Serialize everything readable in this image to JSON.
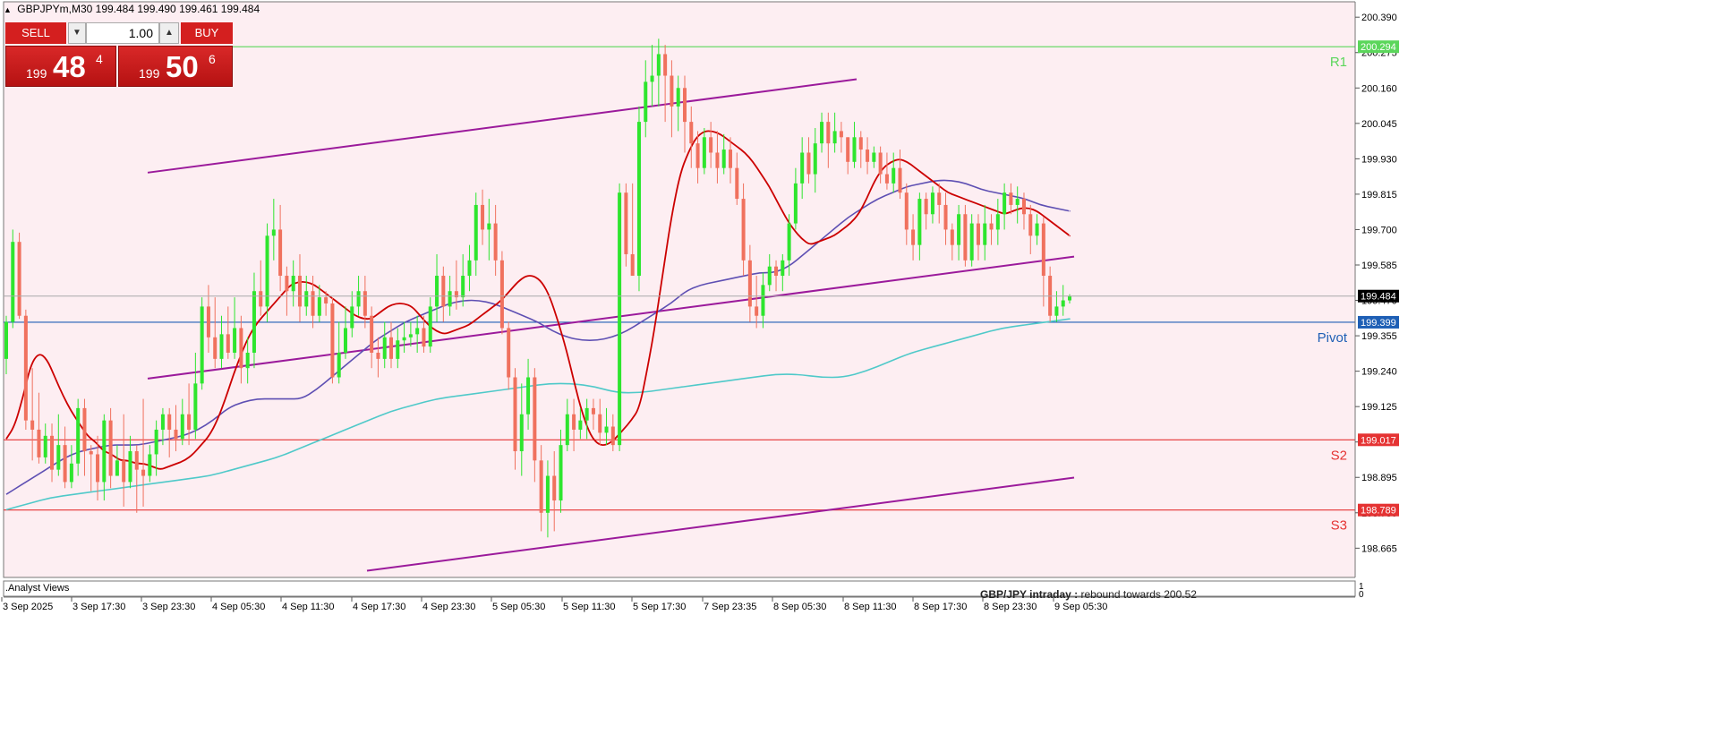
{
  "header": {
    "symbol_timeframe": "GBPJPYm,M30",
    "quote_values": "199.484 199.490 199.461 199.484"
  },
  "trade_panel": {
    "sell_label": "SELL",
    "buy_label": "BUY",
    "lot_value": "1.00",
    "sell_price": {
      "prefix": "199",
      "big": "48",
      "sup": "4"
    },
    "buy_price": {
      "prefix": "199",
      "big": "50",
      "sup": "6"
    }
  },
  "footer": {
    "analyst_label": ".Analyst Views",
    "caption_bold": "GBP/JPY intraday :",
    "caption_rest": " rebound towards 200.52",
    "lower_scale_top": "1",
    "lower_scale_bottom": "0"
  },
  "colors": {
    "background": "#fdeef2",
    "bull_candle": "#2ee52e",
    "bear_candle": "#f0715e",
    "channel": "#9b1a9b",
    "ma_fast": "#cc0000",
    "ma_mid": "#5e4fb3",
    "ma_slow": "#4fc9c9",
    "r1_line": "#5bd65b",
    "pivot_line": "#1e5fb5",
    "support_line": "#e53333"
  },
  "chart_data": {
    "type": "candlestick",
    "ylim": [
      198.57,
      200.44
    ],
    "y_ticks": [
      200.39,
      200.275,
      200.16,
      200.045,
      199.93,
      199.815,
      199.7,
      199.585,
      199.47,
      199.355,
      199.24,
      199.125,
      199.01,
      198.895,
      198.78,
      198.665
    ],
    "x_ticks": [
      "3 Sep 2025",
      "3 Sep 17:30",
      "3 Sep 23:30",
      "4 Sep 05:30",
      "4 Sep 11:30",
      "4 Sep 17:30",
      "4 Sep 23:30",
      "5 Sep 05:30",
      "5 Sep 11:30",
      "5 Sep 17:30",
      "7 Sep 23:35",
      "8 Sep 05:30",
      "8 Sep 11:30",
      "8 Sep 17:30",
      "8 Sep 23:30",
      "9 Sep 05:30"
    ],
    "current_price": 199.484,
    "levels": [
      {
        "name": "R1",
        "value": 200.294
      },
      {
        "name": "Pivot",
        "value": 199.399
      },
      {
        "name": "S2",
        "value": 199.017
      },
      {
        "name": "S3",
        "value": 198.789
      }
    ],
    "level_labels": [
      "200.294",
      "199.399",
      "199.017",
      "198.789"
    ],
    "current_label": "199.484",
    "candles": [
      [
        199.28,
        199.4,
        199.23,
        199.42
      ],
      [
        199.4,
        199.66,
        199.38,
        199.7
      ],
      [
        199.66,
        199.42,
        199.41,
        199.69
      ],
      [
        199.42,
        199.08,
        199.05,
        199.44
      ],
      [
        199.08,
        199.05,
        198.95,
        199.25
      ],
      [
        199.05,
        198.96,
        198.94,
        199.17
      ],
      [
        198.96,
        199.03,
        198.94,
        199.07
      ],
      [
        199.03,
        198.92,
        198.88,
        199.07
      ],
      [
        198.92,
        199.0,
        198.9,
        199.1
      ],
      [
        199.0,
        198.88,
        198.86,
        199.06
      ],
      [
        198.88,
        198.94,
        198.86,
        199.0
      ],
      [
        198.94,
        199.12,
        198.9,
        199.15
      ],
      [
        199.12,
        198.98,
        198.9,
        199.15
      ],
      [
        198.98,
        198.97,
        198.85,
        199.0
      ],
      [
        198.97,
        198.88,
        198.82,
        199.03
      ],
      [
        198.88,
        199.08,
        198.82,
        199.1
      ],
      [
        199.08,
        198.9,
        198.86,
        199.12
      ],
      [
        198.9,
        198.95,
        198.9,
        199.0
      ],
      [
        198.95,
        198.88,
        198.8,
        199.1
      ],
      [
        198.88,
        198.98,
        198.86,
        199.03
      ],
      [
        198.98,
        198.92,
        198.78,
        199.0
      ],
      [
        198.92,
        198.9,
        198.8,
        199.15
      ],
      [
        198.9,
        198.97,
        198.88,
        199.0
      ],
      [
        198.97,
        199.05,
        198.9,
        199.08
      ],
      [
        199.05,
        199.1,
        199.0,
        199.12
      ],
      [
        199.1,
        199.05,
        198.96,
        199.12
      ],
      [
        199.05,
        199.02,
        198.98,
        199.13
      ],
      [
        199.02,
        199.1,
        199.0,
        199.15
      ],
      [
        199.1,
        199.05,
        199.0,
        199.2
      ],
      [
        199.05,
        199.2,
        199.02,
        199.3
      ],
      [
        199.2,
        199.45,
        199.18,
        199.48
      ],
      [
        199.45,
        199.35,
        199.3,
        199.52
      ],
      [
        199.35,
        199.28,
        199.25,
        199.48
      ],
      [
        199.28,
        199.36,
        199.25,
        199.42
      ],
      [
        199.36,
        199.3,
        199.28,
        199.45
      ],
      [
        199.3,
        199.38,
        199.28,
        199.48
      ],
      [
        199.38,
        199.25,
        199.2,
        199.42
      ],
      [
        199.25,
        199.3,
        199.2,
        199.35
      ],
      [
        199.3,
        199.5,
        199.25,
        199.56
      ],
      [
        199.5,
        199.45,
        199.42,
        199.6
      ],
      [
        199.45,
        199.68,
        199.4,
        199.72
      ],
      [
        199.68,
        199.7,
        199.6,
        199.8
      ],
      [
        199.7,
        199.55,
        199.5,
        199.78
      ],
      [
        199.55,
        199.5,
        199.42,
        199.58
      ],
      [
        199.5,
        199.55,
        199.45,
        199.6
      ],
      [
        199.55,
        199.45,
        199.4,
        199.62
      ],
      [
        199.45,
        199.5,
        199.42,
        199.55
      ],
      [
        199.5,
        199.42,
        199.38,
        199.55
      ],
      [
        199.42,
        199.48,
        199.4,
        199.52
      ],
      [
        199.48,
        199.46,
        199.42,
        199.5
      ],
      [
        199.46,
        199.22,
        199.2,
        199.48
      ],
      [
        199.22,
        199.3,
        199.2,
        199.4
      ],
      [
        199.3,
        199.38,
        199.28,
        199.45
      ],
      [
        199.38,
        199.45,
        199.35,
        199.5
      ],
      [
        199.45,
        199.5,
        199.42,
        199.55
      ],
      [
        199.5,
        199.42,
        199.38,
        199.55
      ],
      [
        199.42,
        199.3,
        199.25,
        199.45
      ],
      [
        199.3,
        199.28,
        199.22,
        199.35
      ],
      [
        199.28,
        199.35,
        199.25,
        199.4
      ],
      [
        199.35,
        199.28,
        199.25,
        199.4
      ],
      [
        199.28,
        199.34,
        199.25,
        199.38
      ],
      [
        199.34,
        199.35,
        199.3,
        199.4
      ],
      [
        199.35,
        199.36,
        199.32,
        199.4
      ],
      [
        199.36,
        199.38,
        199.3,
        199.42
      ],
      [
        199.38,
        199.32,
        199.3,
        199.42
      ],
      [
        199.32,
        199.45,
        199.3,
        199.48
      ],
      [
        199.45,
        199.55,
        199.4,
        199.62
      ],
      [
        199.55,
        199.45,
        199.4,
        199.58
      ],
      [
        199.45,
        199.5,
        199.42,
        199.55
      ],
      [
        199.5,
        199.48,
        199.44,
        199.6
      ],
      [
        199.48,
        199.55,
        199.45,
        199.62
      ],
      [
        199.55,
        199.6,
        199.5,
        199.65
      ],
      [
        199.6,
        199.78,
        199.55,
        199.82
      ],
      [
        199.78,
        199.7,
        199.65,
        199.83
      ],
      [
        199.7,
        199.72,
        199.6,
        199.8
      ],
      [
        199.72,
        199.6,
        199.55,
        199.78
      ],
      [
        199.6,
        199.38,
        199.36,
        199.63
      ],
      [
        199.38,
        199.22,
        199.18,
        199.4
      ],
      [
        199.22,
        198.98,
        198.92,
        199.25
      ],
      [
        198.98,
        199.1,
        198.9,
        199.2
      ],
      [
        199.1,
        199.22,
        199.05,
        199.28
      ],
      [
        199.22,
        198.95,
        198.88,
        199.25
      ],
      [
        198.95,
        198.78,
        198.72,
        199.0
      ],
      [
        198.78,
        198.9,
        198.7,
        198.95
      ],
      [
        198.9,
        198.82,
        198.72,
        198.98
      ],
      [
        198.82,
        199.0,
        198.78,
        199.05
      ],
      [
        199.0,
        199.1,
        198.98,
        199.15
      ],
      [
        199.1,
        199.05,
        198.98,
        199.15
      ],
      [
        199.05,
        199.08,
        199.02,
        199.12
      ],
      [
        199.08,
        199.12,
        199.02,
        199.15
      ],
      [
        199.12,
        199.1,
        199.05,
        199.15
      ],
      [
        199.1,
        199.04,
        199.0,
        199.15
      ],
      [
        199.04,
        199.06,
        199.0,
        199.12
      ],
      [
        199.06,
        199.0,
        198.98,
        199.1
      ],
      [
        199.0,
        199.82,
        198.98,
        199.85
      ],
      [
        199.82,
        199.62,
        199.58,
        199.85
      ],
      [
        199.62,
        199.55,
        199.55,
        199.85
      ],
      [
        199.55,
        200.05,
        199.5,
        200.1
      ],
      [
        200.05,
        200.18,
        200.0,
        200.25
      ],
      [
        200.18,
        200.2,
        200.1,
        200.3
      ],
      [
        200.2,
        200.27,
        200.1,
        200.32
      ],
      [
        200.27,
        200.2,
        200.05,
        200.3
      ],
      [
        200.2,
        200.1,
        200.0,
        200.25
      ],
      [
        200.1,
        200.16,
        200.02,
        200.2
      ],
      [
        200.16,
        200.05,
        199.95,
        200.2
      ],
      [
        200.05,
        199.98,
        199.9,
        200.1
      ],
      [
        199.98,
        199.9,
        199.85,
        200.02
      ],
      [
        199.9,
        200.0,
        199.88,
        200.03
      ],
      [
        200.0,
        199.95,
        199.9,
        200.05
      ],
      [
        199.95,
        199.9,
        199.85,
        200.02
      ],
      [
        199.9,
        199.96,
        199.88,
        200.01
      ],
      [
        199.96,
        199.9,
        199.85,
        200.0
      ],
      [
        199.9,
        199.8,
        199.78,
        199.95
      ],
      [
        199.8,
        199.6,
        199.55,
        199.85
      ],
      [
        199.6,
        199.45,
        199.4,
        199.65
      ],
      [
        199.45,
        199.42,
        199.38,
        199.55
      ],
      [
        199.42,
        199.52,
        199.38,
        199.56
      ],
      [
        199.52,
        199.58,
        199.5,
        199.62
      ],
      [
        199.58,
        199.55,
        199.5,
        199.6
      ],
      [
        199.55,
        199.6,
        199.5,
        199.62
      ],
      [
        199.6,
        199.72,
        199.55,
        199.75
      ],
      [
        199.72,
        199.85,
        199.7,
        199.9
      ],
      [
        199.85,
        199.95,
        199.8,
        200.0
      ],
      [
        199.95,
        199.88,
        199.85,
        200.0
      ],
      [
        199.88,
        199.98,
        199.82,
        200.03
      ],
      [
        199.98,
        200.05,
        199.95,
        200.08
      ],
      [
        200.05,
        199.98,
        199.9,
        200.08
      ],
      [
        199.98,
        200.02,
        199.95,
        200.08
      ],
      [
        200.02,
        200.0,
        199.95,
        200.05
      ],
      [
        200.0,
        199.92,
        199.88,
        200.0
      ],
      [
        199.92,
        200.0,
        199.9,
        200.05
      ],
      [
        200.0,
        199.96,
        199.9,
        200.02
      ],
      [
        199.96,
        199.92,
        199.88,
        200.0
      ],
      [
        199.92,
        199.95,
        199.9,
        199.97
      ],
      [
        199.95,
        199.88,
        199.85,
        199.97
      ],
      [
        199.88,
        199.85,
        199.83,
        199.95
      ],
      [
        199.85,
        199.9,
        199.82,
        199.95
      ],
      [
        199.9,
        199.82,
        199.8,
        199.96
      ],
      [
        199.82,
        199.7,
        199.65,
        199.85
      ],
      [
        199.7,
        199.65,
        199.6,
        199.75
      ],
      [
        199.65,
        199.8,
        199.6,
        199.82
      ],
      [
        199.8,
        199.75,
        199.7,
        199.82
      ],
      [
        199.75,
        199.82,
        199.72,
        199.84
      ],
      [
        199.82,
        199.78,
        199.72,
        199.85
      ],
      [
        199.78,
        199.7,
        199.65,
        199.82
      ],
      [
        199.7,
        199.65,
        199.6,
        199.72
      ],
      [
        199.65,
        199.75,
        199.6,
        199.78
      ],
      [
        199.75,
        199.6,
        199.58,
        199.78
      ],
      [
        199.6,
        199.72,
        199.58,
        199.75
      ],
      [
        199.72,
        199.65,
        199.6,
        199.75
      ],
      [
        199.65,
        199.72,
        199.6,
        199.78
      ],
      [
        199.72,
        199.7,
        199.65,
        199.75
      ],
      [
        199.7,
        199.75,
        199.65,
        199.8
      ],
      [
        199.75,
        199.82,
        199.7,
        199.85
      ],
      [
        199.82,
        199.78,
        199.75,
        199.85
      ],
      [
        199.78,
        199.8,
        199.72,
        199.84
      ],
      [
        199.8,
        199.75,
        199.7,
        199.82
      ],
      [
        199.75,
        199.68,
        199.62,
        199.78
      ],
      [
        199.68,
        199.72,
        199.65,
        199.75
      ],
      [
        199.72,
        199.55,
        199.45,
        199.74
      ],
      [
        199.55,
        199.42,
        199.4,
        199.58
      ],
      [
        199.42,
        199.45,
        199.4,
        199.5
      ],
      [
        199.45,
        199.47,
        199.42,
        199.52
      ],
      [
        199.47,
        199.484,
        199.46,
        199.49
      ]
    ],
    "ma_fast": [
      199.02,
      199.06,
      199.15,
      199.26,
      199.3,
      199.28,
      199.22,
      199.16,
      199.11,
      199.07,
      199.03,
      199.01,
      198.98,
      198.97,
      198.95,
      198.95,
      198.94,
      198.94,
      198.93,
      198.92,
      198.93,
      198.94,
      198.95,
      198.97,
      199.0,
      199.03,
      199.08,
      199.15,
      199.23,
      199.3,
      199.36,
      199.4,
      199.43,
      199.46,
      199.49,
      199.52,
      199.53,
      199.53,
      199.52,
      199.5,
      199.48,
      199.46,
      199.44,
      199.42,
      199.41,
      199.41,
      199.43,
      199.45,
      199.46,
      199.46,
      199.45,
      199.42,
      199.39,
      199.37,
      199.36,
      199.37,
      199.38,
      199.39,
      199.41,
      199.43,
      199.45,
      199.47,
      199.5,
      199.53,
      199.55,
      199.55,
      199.53,
      199.48,
      199.4,
      199.31,
      199.2,
      199.1,
      199.03,
      199.0,
      199.0,
      199.02,
      199.05,
      199.08,
      199.12,
      199.25,
      199.4,
      199.58,
      199.75,
      199.88,
      199.95,
      200.0,
      200.02,
      200.02,
      200.01,
      199.99,
      199.97,
      199.95,
      199.92,
      199.88,
      199.84,
      199.79,
      199.74,
      199.7,
      199.67,
      199.65,
      199.66,
      199.67,
      199.68,
      199.7,
      199.72,
      199.75,
      199.8,
      199.86,
      199.9,
      199.92,
      199.93,
      199.92,
      199.9,
      199.88,
      199.86,
      199.84,
      199.82,
      199.81,
      199.8,
      199.79,
      199.78,
      199.77,
      199.76,
      199.75,
      199.76,
      199.77,
      199.77,
      199.76,
      199.74,
      199.72,
      199.7,
      199.68
    ],
    "ma_mid": [
      198.84,
      198.87,
      198.9,
      198.93,
      198.96,
      198.98,
      198.99,
      199.0,
      199.0,
      199.0,
      199.01,
      199.02,
      199.03,
      199.05,
      199.08,
      199.12,
      199.14,
      199.15,
      199.15,
      199.15,
      199.15,
      199.18,
      199.22,
      199.26,
      199.3,
      199.34,
      199.37,
      199.4,
      199.42,
      199.44,
      199.46,
      199.47,
      199.47,
      199.46,
      199.44,
      199.42,
      199.4,
      199.37,
      199.35,
      199.34,
      199.34,
      199.35,
      199.37,
      199.4,
      199.43,
      199.46,
      199.5,
      199.52,
      199.53,
      199.54,
      199.55,
      199.56,
      199.56,
      199.58,
      199.62,
      199.66,
      199.7,
      199.74,
      199.77,
      199.8,
      199.82,
      199.84,
      199.85,
      199.86,
      199.86,
      199.85,
      199.83,
      199.82,
      199.81,
      199.8,
      199.78,
      199.77,
      199.76
    ],
    "ma_slow": [
      198.79,
      198.81,
      198.83,
      198.84,
      198.85,
      198.86,
      198.87,
      198.88,
      198.89,
      198.9,
      198.92,
      198.94,
      198.96,
      198.99,
      199.02,
      199.05,
      199.08,
      199.11,
      199.13,
      199.15,
      199.16,
      199.17,
      199.18,
      199.19,
      199.2,
      199.2,
      199.19,
      199.17,
      199.17,
      199.18,
      199.19,
      199.2,
      199.21,
      199.22,
      199.23,
      199.23,
      199.22,
      199.22,
      199.24,
      199.27,
      199.3,
      199.32,
      199.34,
      199.36,
      199.38,
      199.39,
      199.4,
      199.41
    ]
  }
}
